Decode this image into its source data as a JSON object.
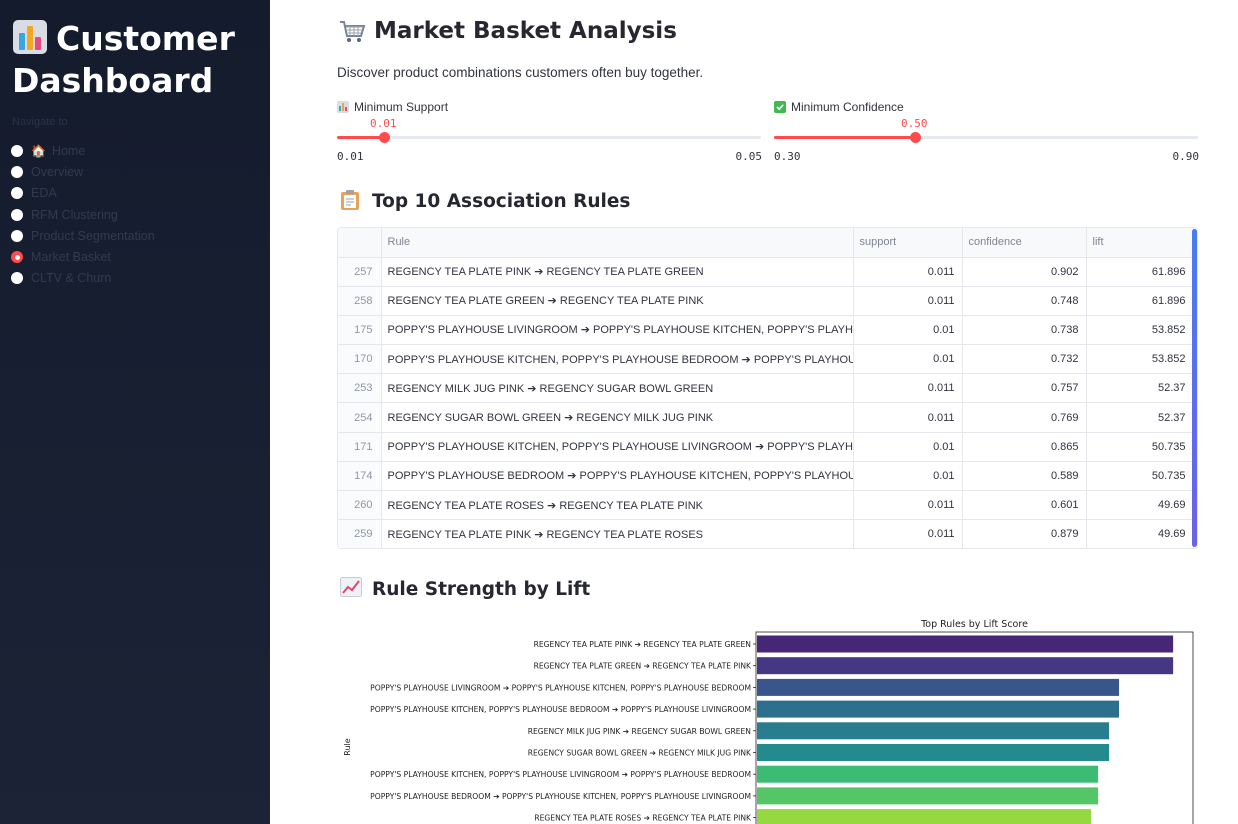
{
  "sidebar": {
    "title": "Customer Dashboard",
    "nav_label": "Navigate to",
    "items": [
      {
        "label": "Home",
        "icon": "house-icon",
        "selected": false
      },
      {
        "label": "Overview",
        "selected": false
      },
      {
        "label": "EDA",
        "selected": false
      },
      {
        "label": "RFM Clustering",
        "selected": false
      },
      {
        "label": "Product Segmentation",
        "selected": false
      },
      {
        "label": "Market Basket",
        "selected": true
      },
      {
        "label": "CLTV & Churn",
        "selected": false
      }
    ]
  },
  "header": {
    "title": "Market Basket Analysis",
    "subtitle": "Discover product combinations customers often buy together."
  },
  "sliders": {
    "support": {
      "label": "Minimum Support",
      "value": "0.01",
      "min": "0.01",
      "max": "0.05",
      "fraction": 0.11
    },
    "confidence": {
      "label": "Minimum Confidence",
      "value": "0.50",
      "min": "0.30",
      "max": "0.90",
      "fraction": 0.333
    }
  },
  "rules_section": {
    "title": "Top 10 Association Rules",
    "columns": [
      "",
      "Rule",
      "support",
      "confidence",
      "lift"
    ],
    "rows": [
      {
        "idx": "257",
        "rule": "REGENCY TEA PLATE PINK ➔ REGENCY TEA PLATE GREEN",
        "support": "0.011",
        "confidence": "0.902",
        "lift": "61.896"
      },
      {
        "idx": "258",
        "rule": "REGENCY TEA PLATE GREEN  ➔ REGENCY TEA PLATE PINK",
        "support": "0.011",
        "confidence": "0.748",
        "lift": "61.896"
      },
      {
        "idx": "175",
        "rule": "POPPY'S PLAYHOUSE LIVINGROOM  ➔ POPPY'S PLAYHOUSE KITCHEN, POPPY'S PLAYHOUSE BEDROOM",
        "support": "0.01",
        "confidence": "0.738",
        "lift": "53.852"
      },
      {
        "idx": "170",
        "rule": "POPPY'S PLAYHOUSE KITCHEN, POPPY'S PLAYHOUSE BEDROOM  ➔ POPPY'S PLAYHOUSE LIVINGROOM",
        "support": "0.01",
        "confidence": "0.732",
        "lift": "53.852"
      },
      {
        "idx": "253",
        "rule": "REGENCY MILK JUG PINK  ➔ REGENCY SUGAR BOWL GREEN",
        "support": "0.011",
        "confidence": "0.757",
        "lift": "52.37"
      },
      {
        "idx": "254",
        "rule": "REGENCY SUGAR BOWL GREEN ➔ REGENCY MILK JUG PINK",
        "support": "0.011",
        "confidence": "0.769",
        "lift": "52.37"
      },
      {
        "idx": "171",
        "rule": "POPPY'S PLAYHOUSE KITCHEN, POPPY'S PLAYHOUSE LIVINGROOM  ➔ POPPY'S PLAYHOUSE BEDROOM",
        "support": "0.01",
        "confidence": "0.865",
        "lift": "50.735"
      },
      {
        "idx": "174",
        "rule": "POPPY'S PLAYHOUSE BEDROOM  ➔ POPPY'S PLAYHOUSE KITCHEN, POPPY'S PLAYHOUSE LIVINGROOM",
        "support": "0.01",
        "confidence": "0.589",
        "lift": "50.735"
      },
      {
        "idx": "260",
        "rule": "REGENCY TEA PLATE ROSES  ➔ REGENCY TEA PLATE PINK",
        "support": "0.011",
        "confidence": "0.601",
        "lift": "49.69"
      },
      {
        "idx": "259",
        "rule": "REGENCY TEA PLATE PINK ➔ REGENCY TEA PLATE ROSES",
        "support": "0.011",
        "confidence": "0.879",
        "lift": "49.69"
      }
    ]
  },
  "chart_section": {
    "title": "Rule Strength by Lift"
  },
  "chart_data": {
    "type": "bar",
    "orientation": "horizontal",
    "title": "Top Rules by Lift Score",
    "xlabel": "",
    "ylabel": "Rule",
    "xlim": [
      0,
      65
    ],
    "palette": [
      "#482677",
      "#453781",
      "#39568c",
      "#2d708e",
      "#287d8e",
      "#238a8d",
      "#3cbb75",
      "#55c667",
      "#95d840"
    ],
    "categories": [
      "REGENCY TEA PLATE PINK ➔ REGENCY TEA PLATE GREEN",
      "REGENCY TEA PLATE GREEN  ➔ REGENCY TEA PLATE PINK",
      "POPPY'S PLAYHOUSE LIVINGROOM  ➔ POPPY'S PLAYHOUSE KITCHEN, POPPY'S PLAYHOUSE BEDROOM",
      "POPPY'S PLAYHOUSE KITCHEN, POPPY'S PLAYHOUSE BEDROOM  ➔ POPPY'S PLAYHOUSE LIVINGROOM",
      "REGENCY MILK JUG PINK  ➔ REGENCY SUGAR BOWL GREEN",
      "REGENCY SUGAR BOWL GREEN ➔ REGENCY MILK JUG PINK",
      "POPPY'S PLAYHOUSE KITCHEN, POPPY'S PLAYHOUSE LIVINGROOM  ➔ POPPY'S PLAYHOUSE BEDROOM",
      "POPPY'S PLAYHOUSE BEDROOM  ➔ POPPY'S PLAYHOUSE KITCHEN, POPPY'S PLAYHOUSE LIVINGROOM",
      "REGENCY TEA PLATE ROSES  ➔ REGENCY TEA PLATE PINK"
    ],
    "values": [
      61.896,
      61.896,
      53.852,
      53.852,
      52.37,
      52.37,
      50.735,
      50.735,
      49.69
    ]
  }
}
